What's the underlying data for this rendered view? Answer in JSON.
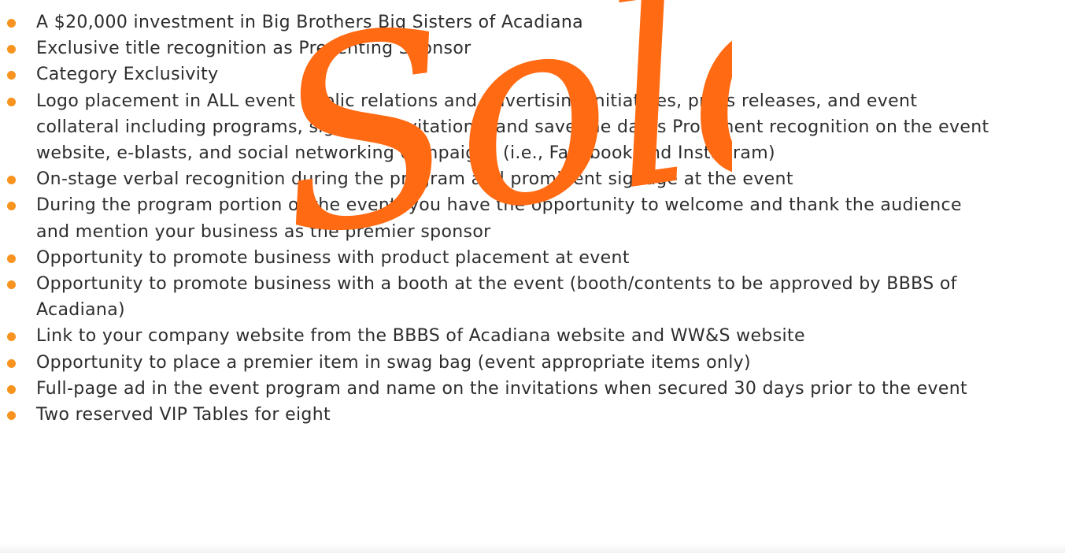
{
  "benefits": [
    {
      "lines": [
        "A $20,000 investment in Big Brothers Big Sisters of Acadiana"
      ]
    },
    {
      "lines": [
        "Exclusive title recognition as Presenting Sponsor"
      ]
    },
    {
      "lines": [
        "Category Exclusivity"
      ]
    },
    {
      "lines": [
        "Logo placement in ALL event public relations and advertising initiatives, press releases, and event",
        "collateral including programs, signage, invitations, and save the dates Prominent recognition on the event",
        "website, e-blasts, and social networking campaigns (i.e., Facebook and Instagram)"
      ]
    },
    {
      "lines": [
        "On-stage verbal recognition during the program and prominent signage at the event"
      ]
    },
    {
      "lines": [
        "During the program portion of the event, you have the opportunity to welcome and thank the audience",
        "and mention your business as the premier sponsor"
      ]
    },
    {
      "lines": [
        "Opportunity to promote business with product placement at event"
      ]
    },
    {
      "lines": [
        "Opportunity to promote business with a booth at the event (booth/contents to be approved by BBBS of",
        "Acadiana)"
      ]
    },
    {
      "lines": [
        "Link to your company website from the BBBS of Acadiana website and WW&S website"
      ]
    },
    {
      "lines": [
        "Opportunity to place a premier item in swag bag (event appropriate items only)"
      ]
    },
    {
      "lines": [
        "Full-page ad in the event program and name on the invitations when secured 30 days prior to the event"
      ]
    },
    {
      "lines": [
        "Two reserved VIP Tables for eight"
      ]
    }
  ],
  "sold_stamp": {
    "text": "Sold",
    "color": "#ff6a13"
  },
  "colors": {
    "bullet": "#f7931e",
    "text": "#2d2d2d",
    "background": "#ffffff"
  }
}
